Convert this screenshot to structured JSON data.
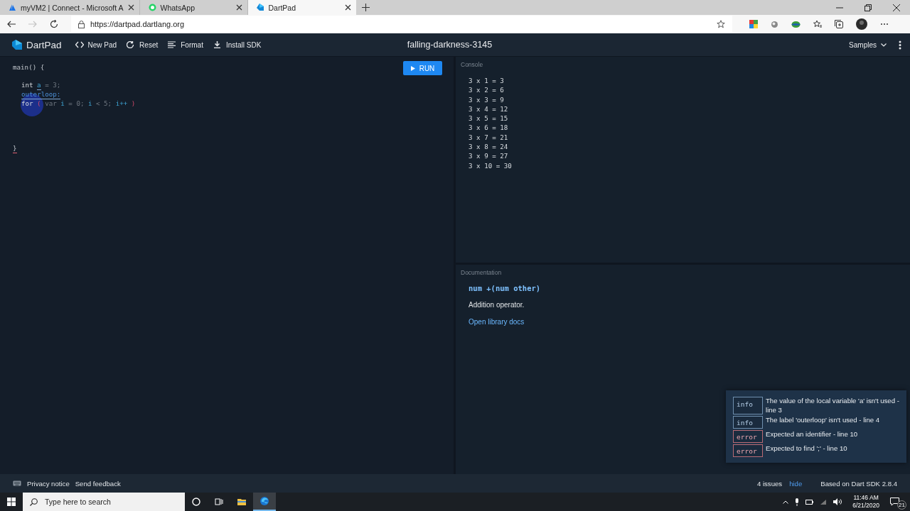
{
  "browser": {
    "tabs": [
      {
        "title": "myVM2 | Connect - Microsoft A",
        "selected": false
      },
      {
        "title": "WhatsApp",
        "selected": false
      },
      {
        "title": "DartPad",
        "selected": true
      }
    ],
    "forward_disabled": true,
    "address": "https://dartpad.dartlang.org"
  },
  "app": {
    "name": "DartPad",
    "actions": [
      "New Pad",
      "Reset",
      "Format",
      "Install SDK"
    ],
    "title": "falling-darkness-3145",
    "samples": "Samples"
  },
  "editor": {
    "run": "RUN",
    "lines": [
      {
        "kind": "code",
        "indented": false,
        "tokens": [
          {
            "t": "main() {",
            "kind": "plain"
          }
        ]
      },
      {
        "kind": "blank"
      },
      {
        "kind": "code",
        "indented": true,
        "tokens": [
          {
            "t": "int",
            "kind": "keyword"
          },
          {
            "t": "a",
            "kind": "ident",
            "underlined": true,
            "is_error": false
          },
          {
            "t": "= 3;",
            "kind": "dim"
          }
        ]
      },
      {
        "kind": "code",
        "indented": true,
        "tokens": [
          {
            "t": "outerloop:",
            "kind": "label",
            "underlined": true,
            "is_error": false
          }
        ]
      },
      {
        "kind": "code",
        "indented": true,
        "tokens": [
          {
            "t": "for",
            "kind": "keyword"
          },
          {
            "t": "(",
            "kind": "bracket"
          },
          {
            "t": "var",
            "kind": "dim"
          },
          {
            "t": "i",
            "kind": "ident"
          },
          {
            "t": "= 0;",
            "kind": "dim"
          },
          {
            "t": "i",
            "kind": "ident"
          },
          {
            "t": "< 5;",
            "kind": "dim"
          },
          {
            "t": "i++",
            "kind": "ident"
          },
          {
            "t": ")",
            "kind": "bracket"
          }
        ]
      },
      {
        "kind": "blank"
      },
      {
        "kind": "blank"
      },
      {
        "kind": "blank"
      },
      {
        "kind": "blank"
      },
      {
        "kind": "code",
        "indented": false,
        "tokens": [
          {
            "t": "}",
            "kind": "plain",
            "underlined": true,
            "is_error": true
          }
        ]
      }
    ]
  },
  "console": {
    "label": "Console",
    "lines": [
      "3 x 1 = 3",
      "3 x 2 = 6",
      "3 x 3 = 9",
      "3 x 4 = 12",
      "3 x 5 = 15",
      "3 x 6 = 18",
      "3 x 7 = 21",
      "3 x 8 = 24",
      "3 x 9 = 27",
      "3 x 10 = 30"
    ]
  },
  "documentation": {
    "label": "Documentation",
    "signature": "num +(num other)",
    "description": "Addition operator.",
    "link": "Open library docs"
  },
  "issues": [
    {
      "kind": "info",
      "tag": "info",
      "message": "The value of the local variable 'a' isn't used - line 3"
    },
    {
      "kind": "info",
      "tag": "info",
      "message": "The label 'outerloop' isn't used - line 4"
    },
    {
      "kind": "error",
      "tag": "error",
      "message": "Expected an identifier - line 10"
    },
    {
      "kind": "error",
      "tag": "error",
      "message": "Expected to find ';' - line 10"
    }
  ],
  "status_bar": {
    "links": [
      "Privacy notice",
      "Send feedback"
    ],
    "issue_count": "4 issues",
    "hide": "hide",
    "sdk": "Based on Dart SDK 2.8.4"
  },
  "taskbar": {
    "search_placeholder": "Type here to search",
    "time": "11:46 AM",
    "date": "6/21/2020",
    "notifications": "21"
  }
}
